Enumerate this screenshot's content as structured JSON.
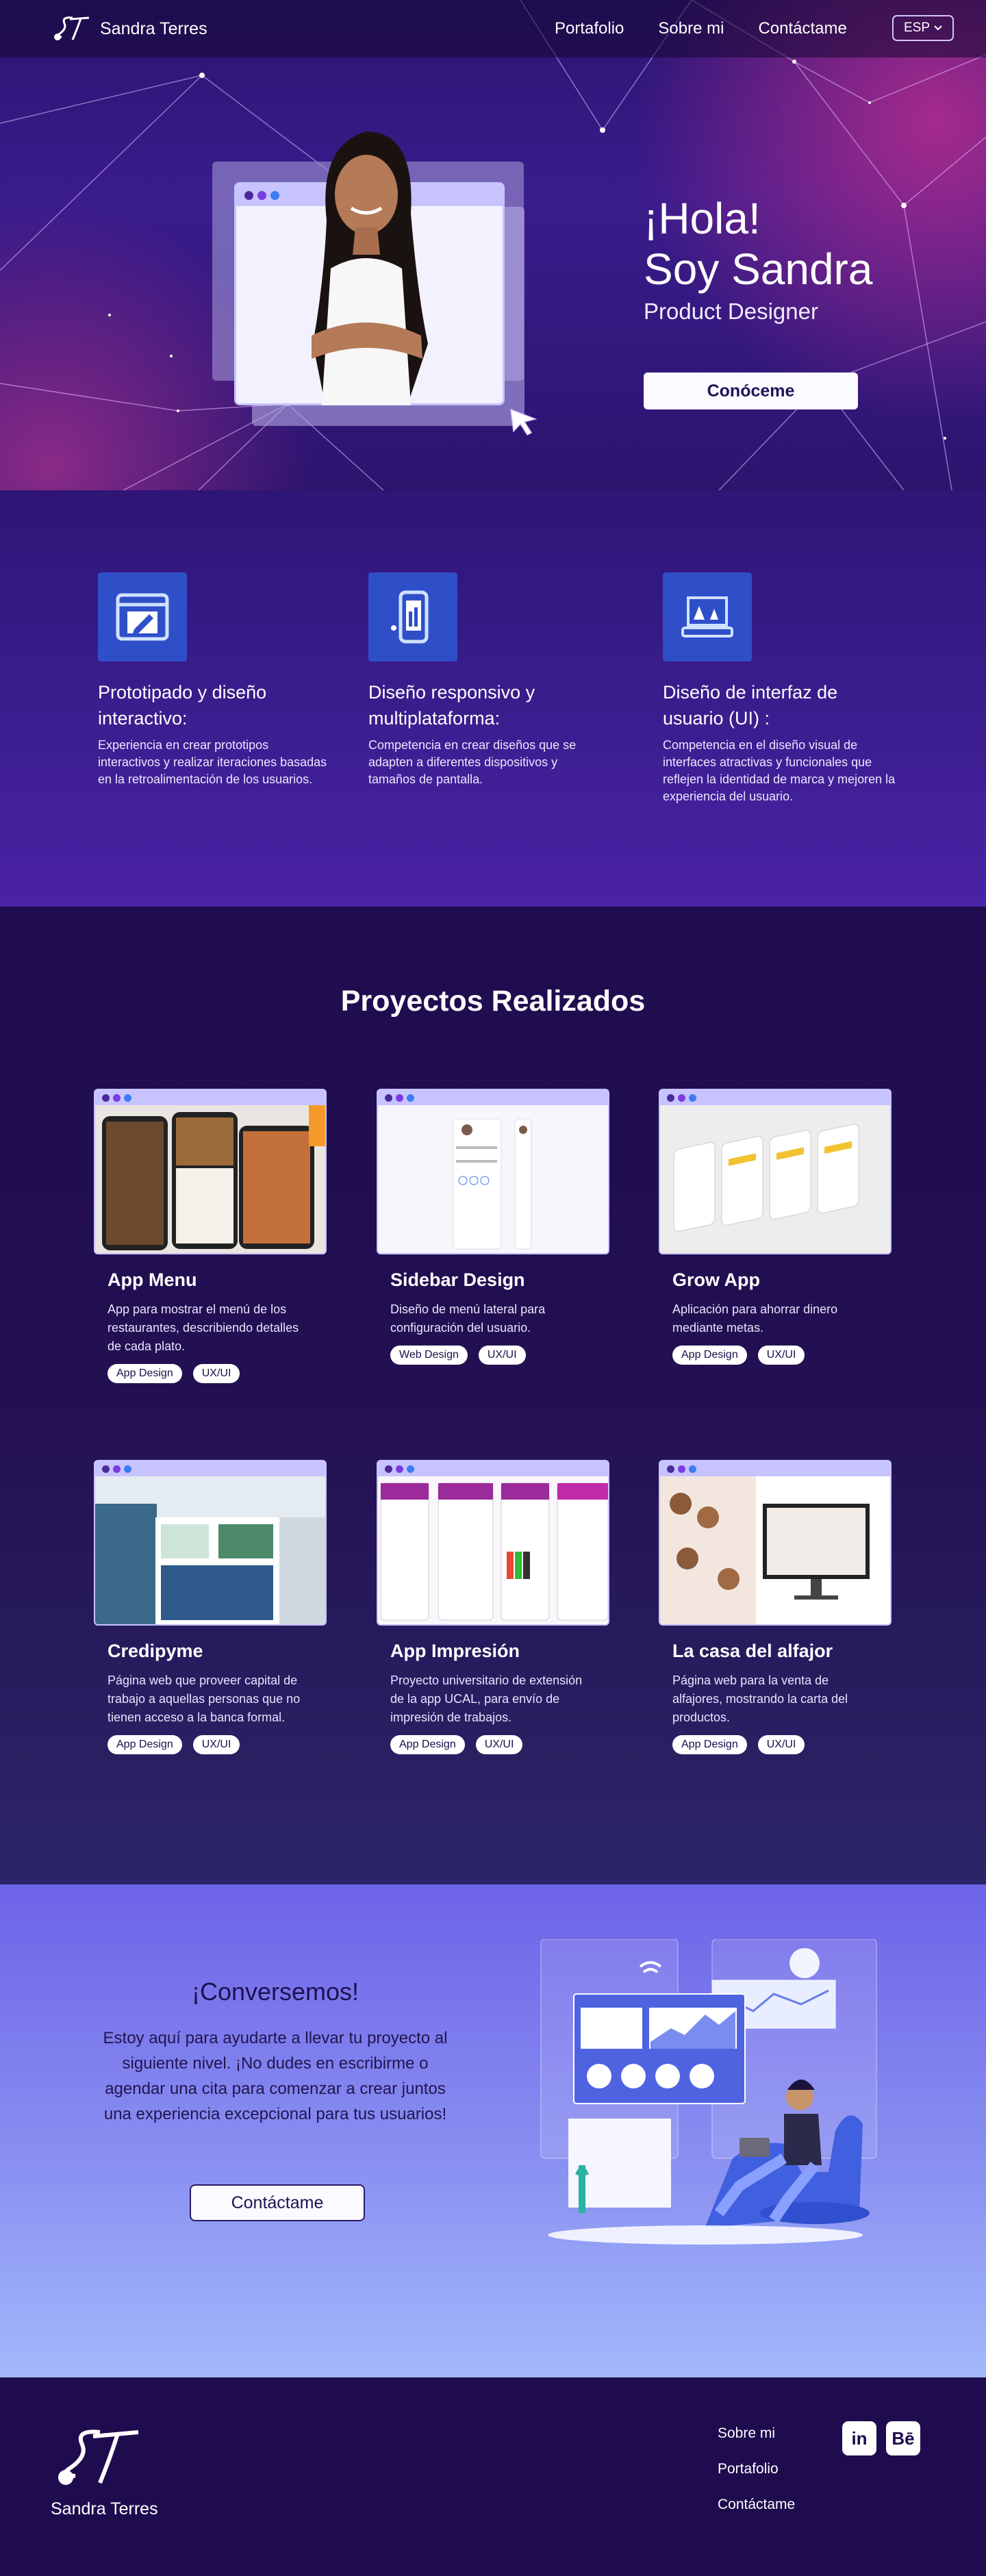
{
  "nav": {
    "brand": "Sandra Terres",
    "links": [
      "Portafolio",
      "Sobre mi",
      "Contáctame"
    ],
    "language": "ESP"
  },
  "hero": {
    "greeting_1": "¡Hola!",
    "greeting_2": "Soy Sandra",
    "role": "Product Designer",
    "cta": "Conóceme"
  },
  "skills": [
    {
      "icon": "edit-window-icon",
      "title": "Prototipado y diseño interactivo:",
      "text": "Experiencia en crear prototipos interactivos y realizar iteraciones basadas en la retroalimentación de los usuarios."
    },
    {
      "icon": "mobile-phone-icon",
      "title": "Diseño responsivo y multiplataforma:",
      "text": "Competencia en crear diseños que se adapten a diferentes dispositivos y tamaños de pantalla."
    },
    {
      "icon": "laptop-design-icon",
      "title": "Diseño de interfaz de usuario (UI) :",
      "text": "Competencia en el diseño visual de interfaces atractivas y funcionales que reflejen la identidad de marca y mejoren la experiencia del usuario."
    }
  ],
  "projects": {
    "title": "Proyectos Realizados",
    "items": [
      {
        "name": "App Menu",
        "desc": "App para mostrar el menú de los restaurantes, describiendo detalles de cada plato.",
        "tags": [
          "App Design",
          "UX/UI"
        ]
      },
      {
        "name": "Sidebar Design",
        "desc": "Diseño de menú lateral para configuración del usuario.",
        "tags": [
          "Web Design",
          "UX/UI"
        ]
      },
      {
        "name": "Grow App",
        "desc": "Aplicación para ahorrar dinero mediante metas.",
        "tags": [
          "App Design",
          "UX/UI"
        ]
      },
      {
        "name": "Credipyme",
        "desc": "Página web que proveer capital de  trabajo a aquellas personas que no tienen acceso a la banca formal.",
        "tags": [
          "App Design",
          "UX/UI"
        ]
      },
      {
        "name": "App Impresión",
        "desc": "Proyecto universitario de extensión de la app  UCAL, para envío de impresión de trabajos.",
        "tags": [
          "App Design",
          "UX/UI"
        ]
      },
      {
        "name": "La casa del alfajor",
        "desc": "Página web para la venta de alfajores, mostrando la carta del productos.",
        "tags": [
          "App Design",
          "UX/UI"
        ]
      }
    ]
  },
  "contact": {
    "title": "¡Conversemos!",
    "text": "Estoy aquí para ayudarte a llevar tu proyecto al siguiente nivel. ¡No dudes en escribirme o agendar una cita para comenzar a crear juntos una experiencia excepcional para tus usuarios!",
    "cta": "Contáctame"
  },
  "footer": {
    "brand": "Sandra Terres",
    "links": [
      "Sobre mi",
      "Portafolio",
      "Contáctame"
    ],
    "social": [
      "linkedin-icon",
      "behance-icon"
    ]
  }
}
